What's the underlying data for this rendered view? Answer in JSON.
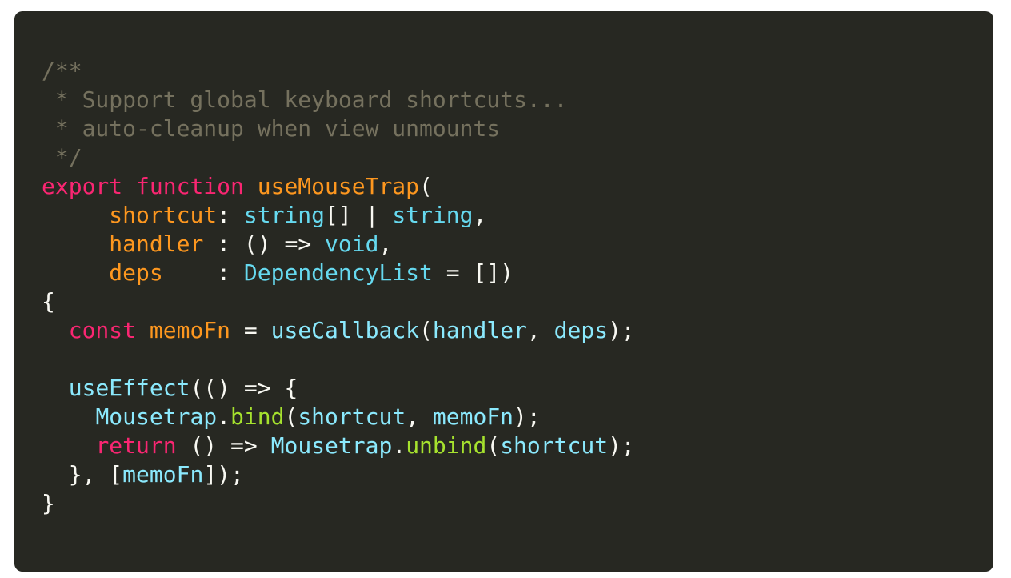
{
  "colors": {
    "background": "#272822",
    "page": "#ffffff",
    "comment": "#75715e",
    "keyword": "#f92672",
    "function_name": "#fd971f",
    "parameter": "#fd971f",
    "type": "#66d9ef",
    "identifier": "#8be9fd",
    "method": "#a6e22e",
    "plain": "#f8f8f2"
  },
  "code": {
    "language": "typescript",
    "lines": [
      [
        {
          "t": "/**",
          "c": "comment"
        }
      ],
      [
        {
          "t": " * Support global keyboard shortcuts...",
          "c": "comment"
        }
      ],
      [
        {
          "t": " * auto-cleanup when view unmounts",
          "c": "comment"
        }
      ],
      [
        {
          "t": " */",
          "c": "comment"
        }
      ],
      [
        {
          "t": "export",
          "c": "keyword"
        },
        {
          "t": " ",
          "c": "plain"
        },
        {
          "t": "function",
          "c": "keyword"
        },
        {
          "t": " ",
          "c": "plain"
        },
        {
          "t": "useMouseTrap",
          "c": "function_name"
        },
        {
          "t": "(",
          "c": "plain"
        }
      ],
      [
        {
          "t": "     ",
          "c": "plain"
        },
        {
          "t": "shortcut",
          "c": "parameter"
        },
        {
          "t": ": ",
          "c": "plain"
        },
        {
          "t": "string",
          "c": "type"
        },
        {
          "t": "[] | ",
          "c": "plain"
        },
        {
          "t": "string",
          "c": "type"
        },
        {
          "t": ",",
          "c": "plain"
        }
      ],
      [
        {
          "t": "     ",
          "c": "plain"
        },
        {
          "t": "handler",
          "c": "parameter"
        },
        {
          "t": " : () => ",
          "c": "plain"
        },
        {
          "t": "void",
          "c": "type"
        },
        {
          "t": ",",
          "c": "plain"
        }
      ],
      [
        {
          "t": "     ",
          "c": "plain"
        },
        {
          "t": "deps",
          "c": "parameter"
        },
        {
          "t": "    : ",
          "c": "plain"
        },
        {
          "t": "DependencyList",
          "c": "type"
        },
        {
          "t": " = [])",
          "c": "plain"
        }
      ],
      [
        {
          "t": "{",
          "c": "plain"
        }
      ],
      [
        {
          "t": "  ",
          "c": "plain"
        },
        {
          "t": "const",
          "c": "keyword"
        },
        {
          "t": " ",
          "c": "plain"
        },
        {
          "t": "memoFn",
          "c": "parameter"
        },
        {
          "t": " = ",
          "c": "plain"
        },
        {
          "t": "useCallback",
          "c": "identifier"
        },
        {
          "t": "(",
          "c": "plain"
        },
        {
          "t": "handler",
          "c": "identifier"
        },
        {
          "t": ", ",
          "c": "plain"
        },
        {
          "t": "deps",
          "c": "identifier"
        },
        {
          "t": ");",
          "c": "plain"
        }
      ],
      [
        {
          "t": "",
          "c": "plain"
        }
      ],
      [
        {
          "t": "  ",
          "c": "plain"
        },
        {
          "t": "useEffect",
          "c": "identifier"
        },
        {
          "t": "(() => {",
          "c": "plain"
        }
      ],
      [
        {
          "t": "    ",
          "c": "plain"
        },
        {
          "t": "Mousetrap",
          "c": "identifier"
        },
        {
          "t": ".",
          "c": "plain"
        },
        {
          "t": "bind",
          "c": "method"
        },
        {
          "t": "(",
          "c": "plain"
        },
        {
          "t": "shortcut",
          "c": "identifier"
        },
        {
          "t": ", ",
          "c": "plain"
        },
        {
          "t": "memoFn",
          "c": "identifier"
        },
        {
          "t": ");",
          "c": "plain"
        }
      ],
      [
        {
          "t": "    ",
          "c": "plain"
        },
        {
          "t": "return",
          "c": "keyword"
        },
        {
          "t": " () => ",
          "c": "plain"
        },
        {
          "t": "Mousetrap",
          "c": "identifier"
        },
        {
          "t": ".",
          "c": "plain"
        },
        {
          "t": "unbind",
          "c": "method"
        },
        {
          "t": "(",
          "c": "plain"
        },
        {
          "t": "shortcut",
          "c": "identifier"
        },
        {
          "t": ");",
          "c": "plain"
        }
      ],
      [
        {
          "t": "  }, [",
          "c": "plain"
        },
        {
          "t": "memoFn",
          "c": "identifier"
        },
        {
          "t": "]);",
          "c": "plain"
        }
      ],
      [
        {
          "t": "}",
          "c": "plain"
        }
      ]
    ]
  }
}
